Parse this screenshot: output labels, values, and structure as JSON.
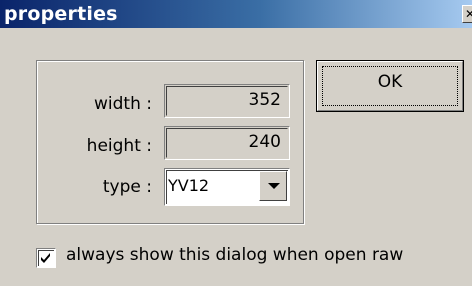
{
  "window": {
    "title": "properties",
    "close_glyph": "✕"
  },
  "form": {
    "width_label": "width :",
    "width_value": "352",
    "height_label": "height :",
    "height_value": "240",
    "type_label": "type :",
    "type_value": "YV12"
  },
  "buttons": {
    "ok_label": "OK"
  },
  "options": {
    "always_show_label": "always show this dialog when open raw",
    "always_show_checked": true
  },
  "icons": [
    "close-icon",
    "chevron-down-icon",
    "check-icon"
  ],
  "colors": {
    "title_start": "#0a246a",
    "title_end": "#a6caf0",
    "face": "#d4d0c8"
  }
}
